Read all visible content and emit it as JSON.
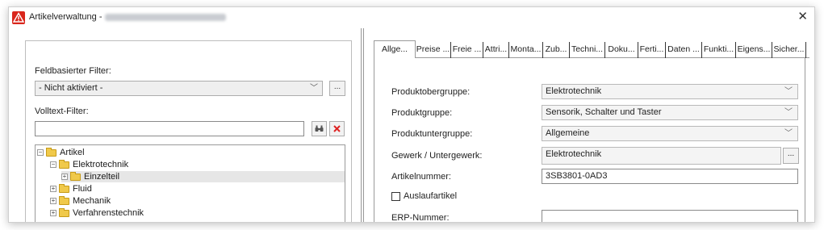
{
  "window": {
    "title": "Artikelverwaltung -",
    "close_glyph": "✕"
  },
  "left_panel": {
    "field_filter_label": "Feldbasierter Filter:",
    "field_filter_value": "- Nicht aktiviert -",
    "field_filter_button": "...",
    "fulltext_label": "Volltext-Filter:",
    "fulltext_value": "",
    "search_icon": "binoculars-icon",
    "clear_icon": "red-x-icon",
    "tree": [
      {
        "label": "Artikel",
        "expander": "⊟"
      },
      {
        "label": "Elektrotechnik",
        "expander": "⊟"
      },
      {
        "label": "Einzelteil",
        "expander": "⊞",
        "selected": true
      },
      {
        "label": "Fluid",
        "expander": "⊞"
      },
      {
        "label": "Mechanik",
        "expander": "⊞"
      },
      {
        "label": "Verfahrenstechnik",
        "expander": "⊞"
      }
    ]
  },
  "tabs": [
    "Allge...",
    "Preise ...",
    "Freie ...",
    "Attri...",
    "Monta...",
    "Zub...",
    "Techni...",
    "Doku...",
    "Ferti...",
    "Daten ...",
    "Funkti...",
    "Eigens...",
    "Sicher..."
  ],
  "active_tab": "Allge...",
  "form": {
    "produktobergruppe_label": "Produktobergruppe:",
    "produktobergruppe_value": "Elektrotechnik",
    "produktgruppe_label": "Produktgruppe:",
    "produktgruppe_value": "Sensorik, Schalter und Taster",
    "produktuntergruppe_label": "Produktuntergruppe:",
    "produktuntergruppe_value": "Allgemeine",
    "gewerk_label": "Gewerk / Untergewerk:",
    "gewerk_value": "Elektrotechnik",
    "gewerk_button": "...",
    "artikelnummer_label": "Artikelnummer:",
    "artikelnummer_value": "3SB3801-0AD3",
    "auslauf_label": "Auslaufartikel",
    "auslauf_checked": false,
    "erp_label": "ERP-Nummer:",
    "erp_value": ""
  }
}
